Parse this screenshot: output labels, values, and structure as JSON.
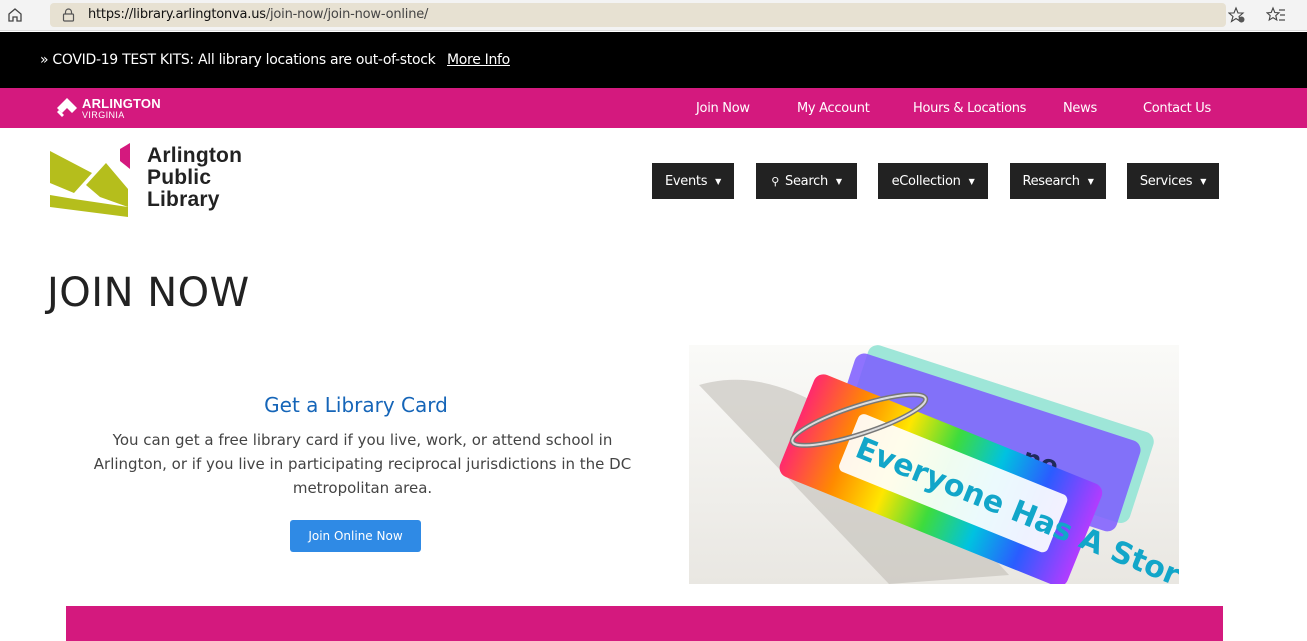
{
  "browser": {
    "url_domain": "https://library.arlingtonva.us",
    "url_path": "/join-now/join-now-online/"
  },
  "alert": {
    "text": "» COVID-19 TEST KITS: All library locations are out-of-stock",
    "link": "More Info"
  },
  "county": {
    "name": "ARLINGTON",
    "sub": "VIRGINIA"
  },
  "top_nav": [
    "Join Now",
    "My Account",
    "Hours & Locations",
    "News",
    "Contact Us"
  ],
  "library": {
    "line1": "Arlington",
    "line2": "Public",
    "line3": "Library"
  },
  "main_nav": {
    "events": "Events",
    "search": "Search",
    "ecollection": "eCollection",
    "research": "Research",
    "services": "Services"
  },
  "page": {
    "title": "JOIN NOW",
    "card_title": "Get a Library Card",
    "card_text": "You can get a free library card if you live, work, or attend school in Arlington, or if you live in participating reciprocal jurisdictions in the DC metropolitan area.",
    "button": "Join Online Now"
  },
  "image": {
    "card_text_front": "Everyone Has A Story",
    "card_text_back": "ne"
  },
  "colors": {
    "brand_pink": "#d4197e",
    "logo_green": "#b5be1c",
    "button_blue": "#2f8ae5",
    "link_blue": "#1565b8"
  }
}
